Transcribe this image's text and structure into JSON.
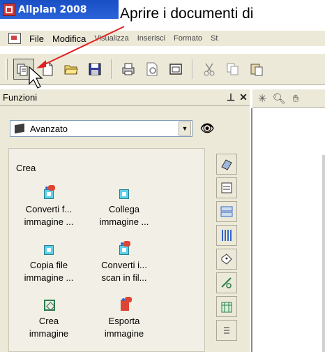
{
  "window": {
    "title": "Allplan 2008"
  },
  "annotation": {
    "text": "Aprire i documenti di"
  },
  "menu": {
    "items": [
      {
        "label": "File"
      },
      {
        "label": "Modifica"
      },
      {
        "label": "Visualizza"
      },
      {
        "label": "Inserisci"
      },
      {
        "label": "Formato"
      },
      {
        "label": "St"
      }
    ]
  },
  "toolbar": {
    "buttons": [
      "open-project-icon",
      "new-document-icon",
      "open-folder-icon",
      "save-icon",
      "print-icon",
      "print-preview-icon",
      "window-icon",
      "cut-icon",
      "copy-icon",
      "paste-icon"
    ],
    "active_button": "open-project-icon"
  },
  "palette": {
    "title": "Funzioni",
    "dropdown_value": "Avanzato",
    "group_label": "Crea",
    "functions": [
      {
        "line1": "Converti f...",
        "line2": "immagine ..."
      },
      {
        "line1": "Collega",
        "line2": "immagine ..."
      },
      {
        "line1": "Copia file",
        "line2": "immagine ..."
      },
      {
        "line1": "Converti i...",
        "line2": "scan in fil..."
      },
      {
        "line1": "Crea",
        "line2": "immagine"
      },
      {
        "line1": "Esporta",
        "line2": "immagine"
      }
    ]
  },
  "colors": {
    "titlebar": "#1a4fc4",
    "chrome": "#ece9d8",
    "arrow": "#e02020",
    "icon_cyan": "#5fd0e8",
    "icon_red": "#dd4433"
  }
}
